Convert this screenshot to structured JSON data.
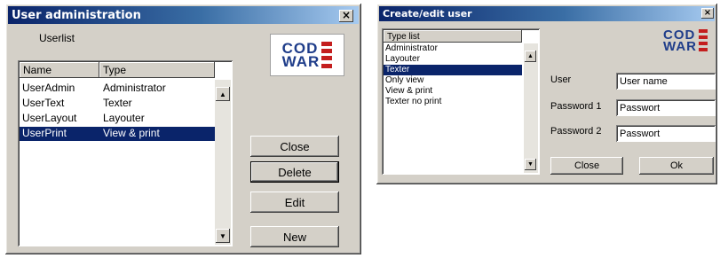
{
  "user_admin": {
    "title": "User administration",
    "close_glyph": "×",
    "userlist_label": "Userlist",
    "columns": {
      "name": "Name",
      "type": "Type"
    },
    "rows": [
      {
        "name": "UserAdmin",
        "type": "Administrator"
      },
      {
        "name": "UserText",
        "type": "Texter"
      },
      {
        "name": "UserLayout",
        "type": "Layouter"
      },
      {
        "name": "UserPrint",
        "type": "View & print",
        "selected": true
      }
    ],
    "buttons": {
      "close": "Close",
      "delete": "Delete",
      "edit": "Edit",
      "new": "New"
    }
  },
  "logo": {
    "line1": "COD",
    "line2": "WAR"
  },
  "create_edit": {
    "title": "Create/edit user",
    "close_glyph": "×",
    "type_list_header": "Type list",
    "types": [
      {
        "label": "Administrator"
      },
      {
        "label": "Layouter"
      },
      {
        "label": "Texter",
        "selected": true
      },
      {
        "label": "Only view"
      },
      {
        "label": "View & print"
      },
      {
        "label": "Texter no print"
      }
    ],
    "fields": {
      "user_label": "User",
      "user_value": "User name",
      "password1_label": "Password 1",
      "password1_value": "Passwort",
      "password2_label": "Password 2",
      "password2_value": "Passwort"
    },
    "buttons": {
      "close": "Close",
      "ok": "Ok"
    }
  },
  "colors": {
    "dialog_face": "#d4d0c8",
    "title_start": "#0a246a",
    "title_end": "#a6caf0",
    "selection": "#0a246a",
    "logo_blue": "#1f3d8a",
    "logo_red": "#c41e1e"
  }
}
